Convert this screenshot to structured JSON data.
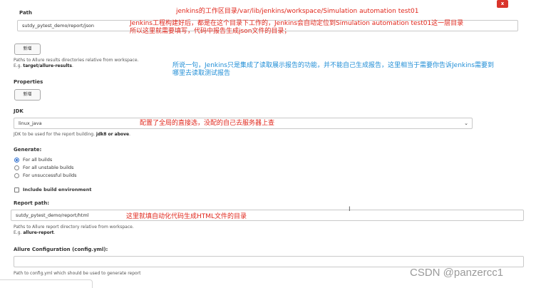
{
  "close_label": "x",
  "path_section": {
    "label": "Path",
    "value": "sutdy_pytest_demo/report/json",
    "add_button": "新增",
    "help_line1": "Paths to Allure results directories relative from workspace.",
    "help_eg_prefix": "E.g. ",
    "help_eg_value": "target/allure-results",
    "help_eg_suffix": "."
  },
  "properties_section": {
    "label": "Properties",
    "add_button": "新增"
  },
  "jdk_section": {
    "label": "JDK",
    "selected": "linux_java",
    "help_prefix": "JDK to be used for the report building. ",
    "help_bold": "jdk8 or above",
    "help_suffix": "."
  },
  "generate_section": {
    "label": "Generate:",
    "options": [
      "For all builds",
      "For all unstable builds",
      "For unsuccessful builds"
    ],
    "selected_index": 0,
    "include_env_label": "Include build environment"
  },
  "report_path_section": {
    "label": "Report path:",
    "value": "sutdy_pytest_demo/report/html",
    "help_line1": "Paths to Allure report directory relative from workspace.",
    "help_eg_prefix": "E.g. ",
    "help_eg_value": "allure-report",
    "help_eg_suffix": "."
  },
  "allure_config_section": {
    "label": "Allure Configuration (config.yml):",
    "value": "",
    "help": "Path to config.yml which should be used to generate report"
  },
  "annotations": {
    "note1_line1": "jenkins的工作区目录/var/lib/jenkins/workspace/Simulation automation test01",
    "note1_line2": "Jenkins工程构建好后，都是在这个目录下工作的，Jenkins会自动定位到Simulation automation test01这一层目录",
    "note1_line3": "所以这里就需要填写，代码中报告生成json文件的目录；",
    "note2_line1": "所说一句，Jenkins只是集成了读取展示报告的功能，并不能自己生成报告，这里相当于需要你告诉Jenkins需要到",
    "note2_line2": "哪里去读取测试报告",
    "note3": "配置了全局的直接选，没配的自己去服务器上查",
    "note4": "这里就填自动化代码生成HTML文件的目录"
  },
  "watermark": "CSDN @panzercc1",
  "colors": {
    "note_red": "#e0261b",
    "note_blue": "#1f8dd6",
    "close_red": "#d9342b"
  }
}
